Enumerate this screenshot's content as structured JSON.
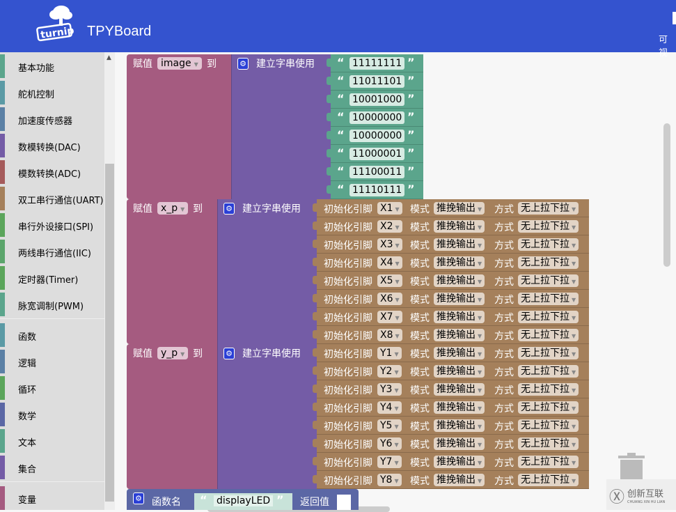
{
  "header": {
    "title": "TPYBoard",
    "logo_text": "turnip",
    "right_label": "可视"
  },
  "colors": {
    "header": "#3453cf",
    "assign": "#a55b80",
    "join": "#745ca6",
    "text": "#5ba58c",
    "pin": "#a5805b",
    "procedure": "#5b67a5"
  },
  "sidebar": {
    "groups": [
      [
        {
          "label": "基本功能",
          "color": "#5ba58c"
        },
        {
          "label": "舵机控制",
          "color": "#5b9aa5"
        },
        {
          "label": "加速度传感器",
          "color": "#5b80a5"
        },
        {
          "label": "数模转换(DAC)",
          "color": "#745ca6"
        },
        {
          "label": "模数转换(ADC)",
          "color": "#a55b5b"
        },
        {
          "label": "双工串行通信(UART)",
          "color": "#a5805b"
        },
        {
          "label": "串行外设接口(SPI)",
          "color": "#5ba55b"
        },
        {
          "label": "两线串行通信(IIC)",
          "color": "#5ba56b"
        },
        {
          "label": "定时器(Timer)",
          "color": "#5ba55b"
        },
        {
          "label": "脉宽调制(PWM)",
          "color": "#5ba58c"
        }
      ],
      [
        {
          "label": "函数",
          "color": "#5b9aa5"
        },
        {
          "label": "逻辑",
          "color": "#5b80a5"
        },
        {
          "label": "循环",
          "color": "#5ba55b"
        },
        {
          "label": "数学",
          "color": "#5b67a5"
        },
        {
          "label": "文本",
          "color": "#5ba58c"
        },
        {
          "label": "集合",
          "color": "#745ca6"
        }
      ],
      [
        {
          "label": "变量",
          "color": "#a55b80"
        }
      ]
    ]
  },
  "blocks": {
    "assign_label": "赋值",
    "to_label": "到",
    "join_label": "建立字串使用",
    "image": {
      "var": "image",
      "strings": [
        "11111111",
        "11011101",
        "10001000",
        "10000000",
        "10000000",
        "11000001",
        "11100011",
        "11110111"
      ]
    },
    "pin_labels": {
      "init": "初始化引脚",
      "mode": "模式",
      "style": "方式"
    },
    "xp": {
      "var": "x_p",
      "pins": [
        {
          "pin": "X1",
          "mode": "推挽输出",
          "pull": "无上拉下拉"
        },
        {
          "pin": "X2",
          "mode": "推挽输出",
          "pull": "无上拉下拉"
        },
        {
          "pin": "X3",
          "mode": "推挽输出",
          "pull": "无上拉下拉"
        },
        {
          "pin": "X4",
          "mode": "推挽输出",
          "pull": "无上拉下拉"
        },
        {
          "pin": "X5",
          "mode": "推挽输出",
          "pull": "无上拉下拉"
        },
        {
          "pin": "X6",
          "mode": "推挽输出",
          "pull": "无上拉下拉"
        },
        {
          "pin": "X7",
          "mode": "推挽输出",
          "pull": "无上拉下拉"
        },
        {
          "pin": "X8",
          "mode": "推挽输出",
          "pull": "无上拉下拉"
        }
      ]
    },
    "yp": {
      "var": "y_p",
      "pins": [
        {
          "pin": "Y1",
          "mode": "推挽输出",
          "pull": "无上拉下拉"
        },
        {
          "pin": "Y2",
          "mode": "推挽输出",
          "pull": "无上拉下拉"
        },
        {
          "pin": "Y3",
          "mode": "推挽输出",
          "pull": "无上拉下拉"
        },
        {
          "pin": "Y4",
          "mode": "推挽输出",
          "pull": "无上拉下拉"
        },
        {
          "pin": "Y5",
          "mode": "推挽输出",
          "pull": "无上拉下拉"
        },
        {
          "pin": "Y6",
          "mode": "推挽输出",
          "pull": "无上拉下拉"
        },
        {
          "pin": "Y7",
          "mode": "推挽输出",
          "pull": "无上拉下拉"
        },
        {
          "pin": "Y8",
          "mode": "推挽输出",
          "pull": "无上拉下拉"
        }
      ]
    },
    "procedure": {
      "name_label": "函数名",
      "name": "displayLED",
      "return_label": "返回值"
    }
  },
  "watermark": {
    "text": "创新互联",
    "sub": "CHUANG XIN HU LIAN"
  }
}
